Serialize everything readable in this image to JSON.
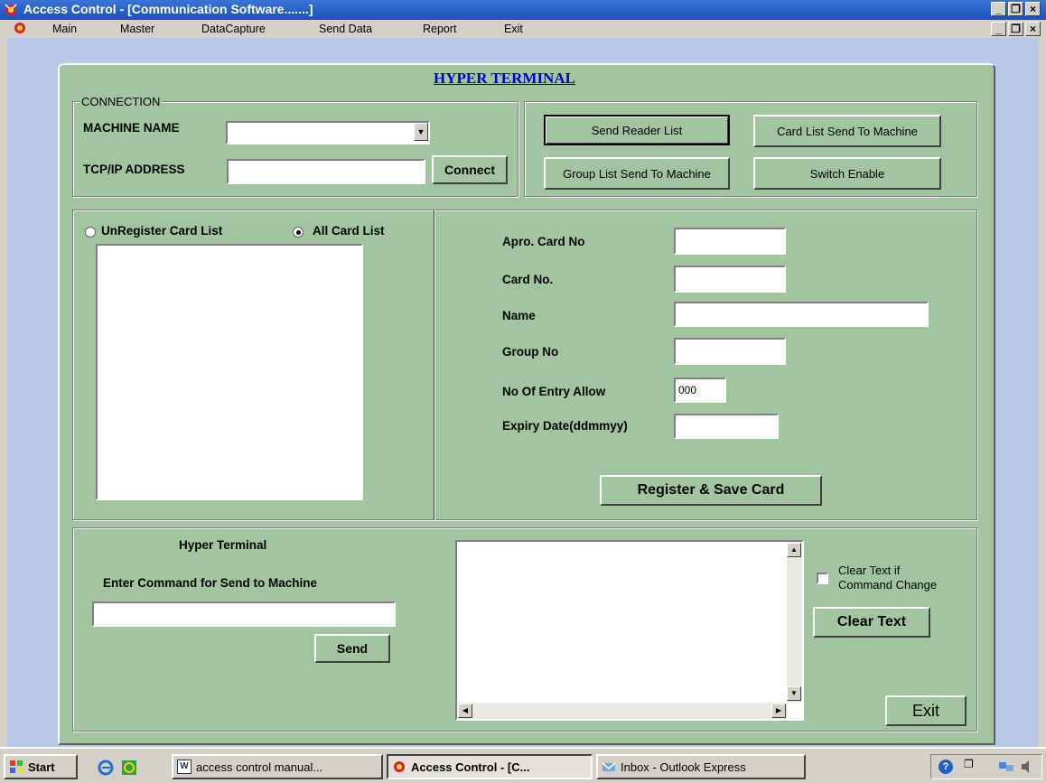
{
  "window": {
    "title": "Access Control - [Communication Software.......]"
  },
  "menu": {
    "items": [
      "Main",
      "Master",
      "DataCapture",
      "Send Data",
      "Report",
      "Exit"
    ]
  },
  "form": {
    "heading": "HYPER TERMINAL",
    "connection": {
      "group_label": "CONNECTION",
      "machine_name_label": "MACHINE NAME",
      "machine_name_value": "",
      "tcp_label": "TCP/IP ADDRESS",
      "tcp_value": "",
      "connect_label": "Connect"
    },
    "actions": {
      "send_reader_list": "Send Reader List",
      "card_list_send": "Card List Send To Machine",
      "group_list_send": "Group List Send To Machine",
      "switch_enable": "Switch Enable"
    },
    "card_list": {
      "unregister_label": "UnRegister Card List",
      "all_label": "All Card List",
      "selected": "all"
    },
    "card_details": {
      "apro_card_label": "Apro. Card No",
      "apro_card_value": "",
      "card_no_label": "Card No.",
      "card_no_value": "",
      "name_label": "Name",
      "name_value": "",
      "group_no_label": "Group No",
      "group_no_value": "",
      "entry_allow_label": "No Of Entry Allow",
      "entry_allow_value": "000",
      "expiry_label": "Expiry Date(ddmmyy)",
      "expiry_value": "",
      "register_button": "Register & Save Card"
    },
    "terminal": {
      "title": "Hyper Terminal",
      "command_label": "Enter Command for Send to Machine",
      "command_value": "",
      "send_button": "Send",
      "output_text": "",
      "clear_if_change_label_1": "Clear Text if",
      "clear_if_change_label_2": "Command Change",
      "clear_if_change_checked": false,
      "clear_text_button": "Clear Text",
      "exit_button": "Exit"
    }
  },
  "taskbar": {
    "start_label": "Start",
    "tasks": [
      "access control manual...",
      "Access Control - [C...",
      "Inbox - Outlook Express"
    ]
  },
  "colors": {
    "form_bg": "#a3c4a1",
    "titlebar": "#1c50bd",
    "heading_link": "#0000cc"
  }
}
